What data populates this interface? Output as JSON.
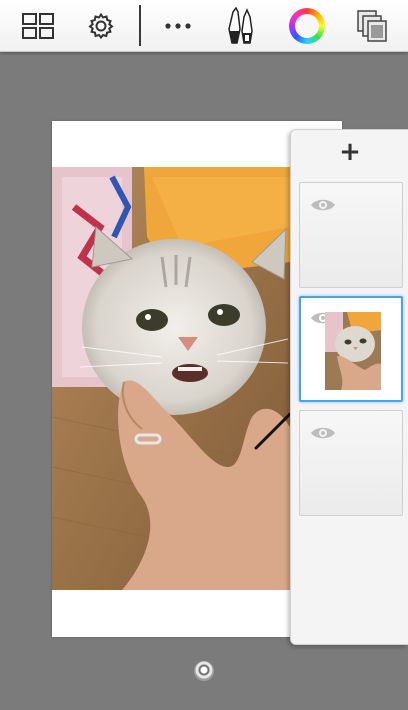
{
  "toolbar": {
    "icons": [
      "gallery-grid-icon",
      "settings-gear-icon",
      "more-options-icon",
      "brush-tools-icon",
      "color-wheel-icon",
      "layers-icon"
    ]
  },
  "layers_panel": {
    "add_label": "+",
    "layers": [
      {
        "visible": true,
        "has_content": false,
        "selected": false
      },
      {
        "visible": true,
        "has_content": true,
        "selected": true
      },
      {
        "visible": true,
        "has_content": false,
        "selected": false
      }
    ]
  },
  "colors": {
    "toolbar_bg": "#f4f4f4",
    "canvas_bg": "#7b7b7b",
    "selected_layer_border": "#4aa3e8"
  }
}
